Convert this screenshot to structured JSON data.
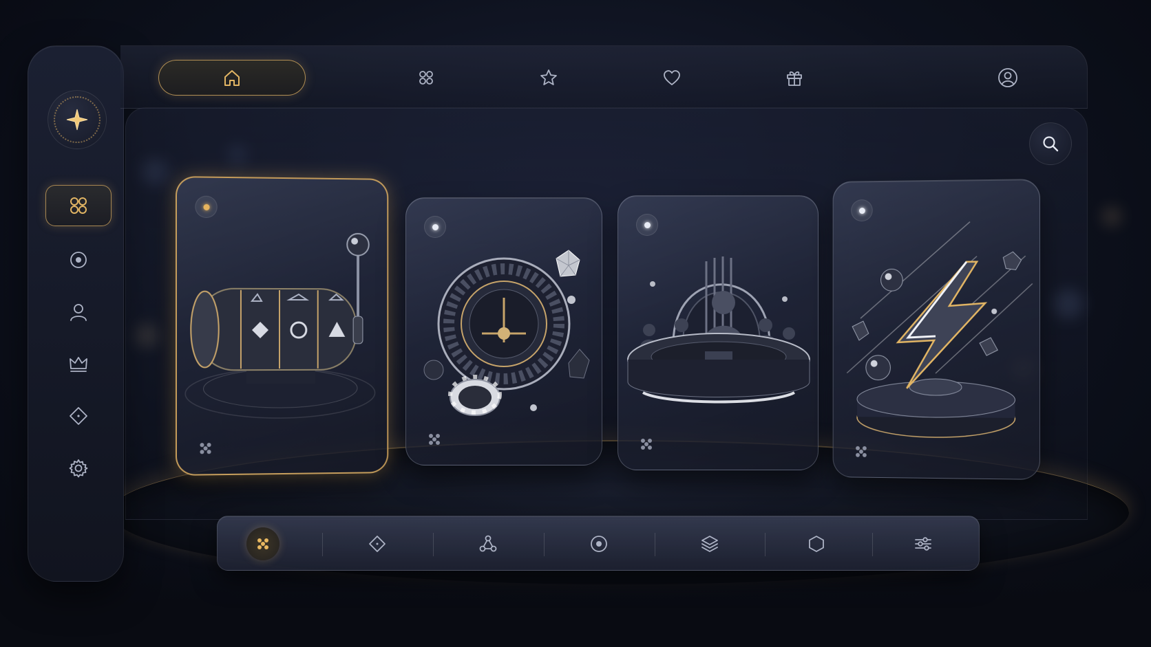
{
  "colors": {
    "accent_gold": "#e2b564",
    "background": "#0d111d",
    "panel": "#1b2032",
    "icon": "#aeb4c6"
  },
  "sidebar": {
    "logo_icon": "sparkle-icon",
    "items": [
      {
        "icon": "grid-icon",
        "active": true
      },
      {
        "icon": "target-icon",
        "active": false
      },
      {
        "icon": "user-icon",
        "active": false
      },
      {
        "icon": "crown-icon",
        "active": false
      },
      {
        "icon": "diamond-icon",
        "active": false
      },
      {
        "icon": "gear-icon",
        "active": false
      }
    ]
  },
  "topbar": {
    "items": [
      {
        "icon": "home-icon",
        "active": true
      },
      {
        "icon": "grid-icon",
        "active": false
      },
      {
        "icon": "star-icon",
        "active": false
      },
      {
        "icon": "heart-icon",
        "active": false
      },
      {
        "icon": "gift-icon",
        "active": false
      }
    ],
    "profile_icon": "profile-icon"
  },
  "search": {
    "icon": "search-icon"
  },
  "cards": [
    {
      "id": "slots",
      "illustration": "slot-machine",
      "active": true
    },
    {
      "id": "roulette",
      "illustration": "roulette-wheel",
      "active": false
    },
    {
      "id": "live-table",
      "illustration": "live-dealer-table",
      "active": false
    },
    {
      "id": "instant",
      "illustration": "lightning-bolt",
      "active": false
    }
  ],
  "toolbar": {
    "items": [
      {
        "icon": "dice-dots-icon",
        "active": true
      },
      {
        "icon": "diamond-icon",
        "active": false
      },
      {
        "icon": "network-icon",
        "active": false
      },
      {
        "icon": "target-icon",
        "active": false
      },
      {
        "icon": "layers-icon",
        "active": false
      },
      {
        "icon": "hexagon-icon",
        "active": false
      },
      {
        "icon": "sliders-icon",
        "active": false
      }
    ]
  }
}
